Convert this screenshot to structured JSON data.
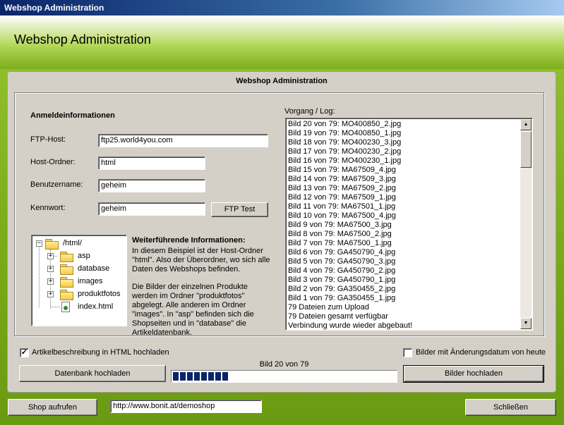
{
  "window": {
    "title": "Webshop Administration"
  },
  "header": {
    "title": "Webshop Administration"
  },
  "panel": {
    "title": "Webshop Administration"
  },
  "login": {
    "heading": "Anmeldeinformationen",
    "ftp_host_label": "FTP-Host:",
    "ftp_host_value": "ftp25.world4you.com",
    "host_folder_label": "Host-Ordner:",
    "host_folder_value": "html",
    "username_label": "Benutzername:",
    "username_value": "geheim",
    "password_label": "Kennwort:",
    "password_value": "geheim",
    "ftp_test_label": "FTP Test"
  },
  "tree": {
    "root": "/html/",
    "children": [
      "asp",
      "database",
      "images",
      "produktfotos",
      "index.html"
    ]
  },
  "info": {
    "heading": "Weiterführende Informationen:",
    "paragraph1": "In diesem Beispiel ist der Host-Ordner \"html\". Also der Überordner, wo sich alle Daten des Webshops befinden.",
    "paragraph2": "Die Bilder der einzelnen Produkte werden im Ordner \"produktfotos\" abgelegt. Alle anderen im Ordner \"images\". In \"asp\" befinden sich die Shopseiten und in \"database\" die Artikeldatenbank."
  },
  "log": {
    "label": "Vorgang / Log:",
    "items": [
      "Bild 20 von 79: MO400850_2.jpg",
      "Bild 19 von 79: MO400850_1.jpg",
      "Bild 18 von 79: MO400230_3.jpg",
      "Bild 17 von 79: MO400230_2.jpg",
      "Bild 16 von 79: MO400230_1.jpg",
      "Bild 15 von 79: MA67509_4.jpg",
      "Bild 14 von 79: MA67509_3.jpg",
      "Bild 13 von 79: MA67509_2.jpg",
      "Bild 12 von 79: MA67509_1.jpg",
      "Bild 11 von 79: MA67501_1.jpg",
      "Bild 10 von 79: MA67500_4.jpg",
      "Bild 9 von 79: MA67500_3.jpg",
      "Bild 8 von 79: MA67500_2.jpg",
      "Bild 7 von 79: MA67500_1.jpg",
      "Bild 6 von 79: GA450790_4.jpg",
      "Bild 5 von 79: GA450790_3.jpg",
      "Bild 4 von 79: GA450790_2.jpg",
      "Bild 3 von 79: GA450790_1.jpg",
      "Bild 2 von 79: GA350455_2.jpg",
      "Bild 1 von 79: GA350455_1.jpg",
      "79 Dateien zum Upload",
      "79 Dateien gesamt verfügbar",
      "Verbindung wurde wieder abgebaut!"
    ]
  },
  "options": {
    "html_desc_label": "Artikelbeschreibung in HTML hochladen",
    "html_desc_checked": true,
    "today_images_label": "Bilder mit Änderungsdatum von heute",
    "today_images_checked": false
  },
  "upload": {
    "db_button": "Datenbank hochladen",
    "progress_text": "Bild 20 von 79",
    "progress_fraction": 0.253,
    "images_button": "Bilder hochladen"
  },
  "footer": {
    "shop_button": "Shop aufrufen",
    "url_value": "http://www.bonit.at/demoshop",
    "close_button": "Schließen"
  }
}
